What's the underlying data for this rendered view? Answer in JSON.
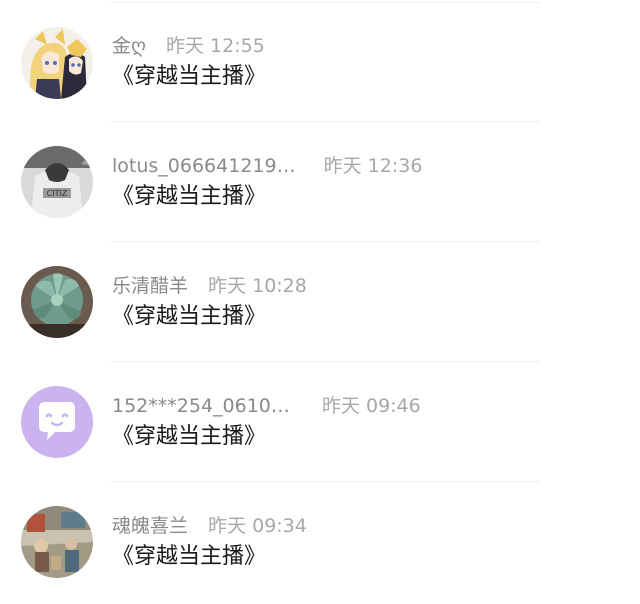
{
  "comments": [
    {
      "name": "金ღ",
      "time": "昨天 12:55",
      "content": "《穿越当主播》",
      "avatar_icon": "anime-characters-avatar"
    },
    {
      "name": "lotus_066641219…",
      "time": "昨天 12:36",
      "content": "《穿越当主播》",
      "avatar_icon": "bw-photo-avatar"
    },
    {
      "name": "乐清醋羊",
      "time": "昨天 10:28",
      "content": "《穿越当主播》",
      "avatar_icon": "succulent-plant-avatar"
    },
    {
      "name": "152***254_0610…",
      "time": "昨天 09:46",
      "content": "《穿越当主播》",
      "avatar_icon": "purple-chat-bubble-avatar"
    },
    {
      "name": "魂魄喜兰",
      "time": "昨天 09:34",
      "content": "《穿越当主播》",
      "avatar_icon": "street-photo-avatar"
    }
  ],
  "colors": {
    "avatar_purple": "#cbb3f0",
    "name_gray": "#8a8a8a",
    "time_gray": "#a8a8a8",
    "content_text": "#1a1a1a"
  }
}
